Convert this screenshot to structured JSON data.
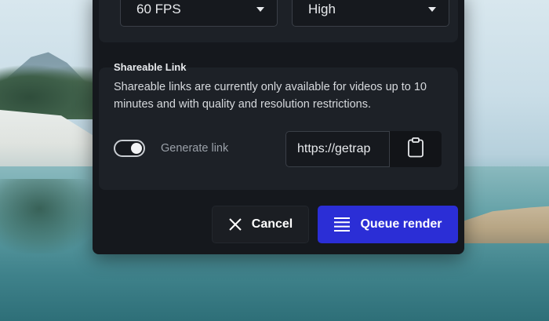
{
  "render_settings": {
    "frame_rate": {
      "value": "60 FPS",
      "icon": "chevron-down-icon"
    },
    "quality": {
      "value": "High",
      "icon": "chevron-down-icon"
    }
  },
  "shareable_link": {
    "title": "Shareable Link",
    "description": "Shareable links are currently only available for videos up to 10 minutes and with quality and resolution restrictions.",
    "generate_toggle": {
      "label": "Generate link",
      "on": true
    },
    "url_value": "https://getrap",
    "copy_icon": "clipboard-icon"
  },
  "actions": {
    "cancel_label": "Cancel",
    "cancel_icon": "close-icon",
    "queue_label": "Queue render",
    "queue_icon": "list-icon"
  },
  "colors": {
    "primary_button": "#2b2ed6",
    "dialog_background": "#15181d",
    "panel_background": "#1d2127"
  }
}
